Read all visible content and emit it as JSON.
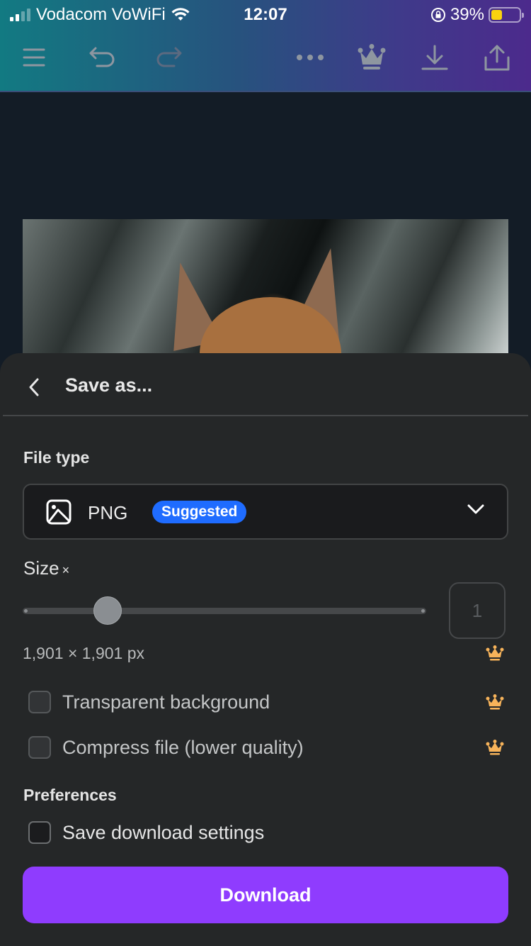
{
  "status_bar": {
    "carrier": "Vodacom VoWiFi",
    "time": "12:07",
    "battery_percent": "39%",
    "battery_level": 0.39
  },
  "toolbar": {
    "icons": [
      "menu-icon",
      "undo-icon",
      "redo-icon",
      "more-icon",
      "crown-icon",
      "download-icon",
      "share-icon"
    ]
  },
  "sheet": {
    "title": "Save as...",
    "file_type": {
      "label": "File type",
      "selected": "PNG",
      "badge": "Suggested",
      "icon": "image-icon"
    },
    "size": {
      "label": "Size",
      "suffix": "×",
      "value": "1",
      "slider_fraction": 0.21,
      "dimensions": "1,901 × 1,901 px"
    },
    "options": [
      {
        "label": "Transparent background",
        "checked": false,
        "premium": true
      },
      {
        "label": "Compress file (lower quality)",
        "checked": false,
        "premium": true
      }
    ],
    "preferences": {
      "label": "Preferences",
      "save_settings": {
        "label": "Save download settings",
        "checked": false
      }
    },
    "download_label": "Download"
  },
  "colors": {
    "accent": "#8f3cfe",
    "badge": "#1f6cff",
    "premium_crown": "#f7b35a",
    "sheet_bg": "#252728"
  }
}
